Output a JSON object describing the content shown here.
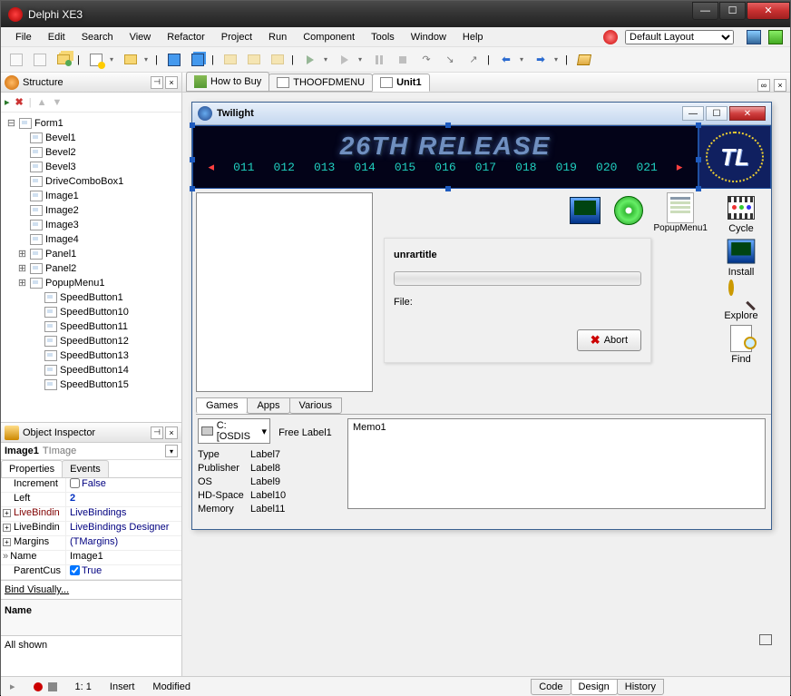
{
  "window": {
    "title": "Delphi XE3"
  },
  "menu": [
    "File",
    "Edit",
    "Search",
    "View",
    "Refactor",
    "Project",
    "Run",
    "Component",
    "Tools",
    "Window",
    "Help"
  ],
  "layout_combo": "Default Layout",
  "structure": {
    "title": "Structure",
    "root": "Form1",
    "items": [
      "Bevel1",
      "Bevel2",
      "Bevel3",
      "DriveComboBox1",
      "Image1",
      "Image2",
      "Image3",
      "Image4"
    ],
    "expandable": [
      {
        "label": "Panel1",
        "exp": "+"
      },
      {
        "label": "Panel2",
        "exp": "+"
      },
      {
        "label": "PopupMenu1",
        "exp": "+"
      }
    ],
    "more": [
      "SpeedButton1",
      "SpeedButton10",
      "SpeedButton11",
      "SpeedButton12",
      "SpeedButton13",
      "SpeedButton14",
      "SpeedButton15"
    ]
  },
  "inspector": {
    "title": "Object Inspector",
    "obj_name": "Image1",
    "obj_type": "TImage",
    "tabs": [
      "Properties",
      "Events"
    ],
    "props": [
      {
        "name": "Increment",
        "value": "False",
        "cls": "darkblue",
        "check": true,
        "exp": false
      },
      {
        "name": "Left",
        "value": "2",
        "cls": "blue bold",
        "exp": false
      },
      {
        "name": "LiveBindin",
        "value": "LiveBindings",
        "cls": "darkblue",
        "exp": true,
        "namecls": "maroon"
      },
      {
        "name": "LiveBindin",
        "value": "LiveBindings Designer",
        "cls": "darkblue",
        "exp": true
      },
      {
        "name": "Margins",
        "value": "(TMargins)",
        "cls": "darkblue",
        "exp": true
      },
      {
        "name": "Name",
        "value": "Image1",
        "cls": "",
        "exp": false,
        "sel": true
      },
      {
        "name": "ParentCus",
        "value": "True",
        "cls": "darkblue",
        "check": true,
        "exp": false
      }
    ],
    "link": "Bind Visually...",
    "name_label": "Name",
    "all_shown": "All shown"
  },
  "ide_tabs": [
    {
      "label": "How to Buy",
      "icon": "home"
    },
    {
      "label": "THOOFDMENU",
      "icon": "form"
    },
    {
      "label": "Unit1",
      "icon": "form",
      "active": true
    }
  ],
  "form": {
    "title": "Twilight",
    "banner_text": "26TH RELEASE",
    "banner_nums": [
      "011",
      "012",
      "013",
      "014",
      "015",
      "016",
      "017",
      "018",
      "019",
      "020",
      "021"
    ],
    "logo": "TL",
    "popup_label": "PopupMenu1",
    "side": [
      "Cycle",
      "Install",
      "Explore",
      "Find"
    ],
    "unrar": {
      "title": "unrartitle",
      "file_label": "File:",
      "abort": "Abort"
    },
    "subtabs": [
      "Games",
      "Apps",
      "Various"
    ],
    "drive": "C: [OSDIS",
    "free_label": "Free Label1",
    "info": [
      {
        "k": "Type",
        "v": "Label7"
      },
      {
        "k": "Publisher",
        "v": "Label8"
      },
      {
        "k": "OS",
        "v": "Label9"
      },
      {
        "k": "HD-Space",
        "v": "Label10"
      },
      {
        "k": "Memory",
        "v": "Label11"
      }
    ],
    "memo": "Memo1"
  },
  "status": {
    "pos": "1: 1",
    "mode": "Insert",
    "state": "Modified",
    "tabs": [
      "Code",
      "Design",
      "History"
    ]
  }
}
